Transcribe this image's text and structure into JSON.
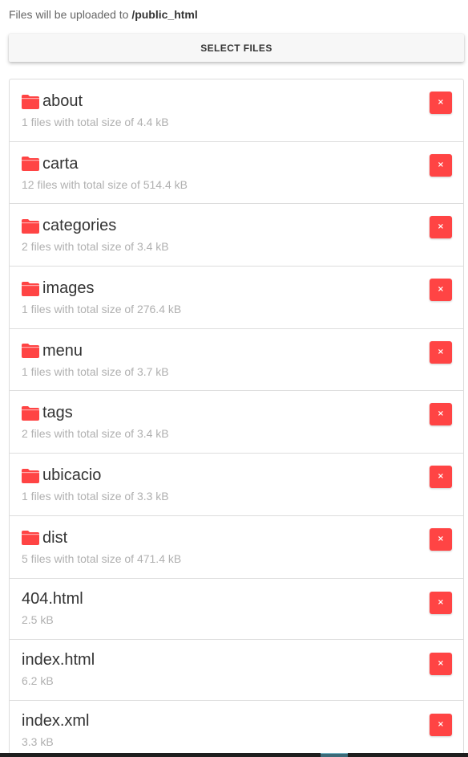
{
  "upload_info": {
    "prefix": "Files will be uploaded to",
    "path": "/public_html"
  },
  "select_button": {
    "label": "SELECT FILES"
  },
  "colors": {
    "accent_red": "#ff4444",
    "folder_icon": "#ff4444",
    "meta_text": "#b0b0b0"
  },
  "items": [
    {
      "type": "folder",
      "icon": "folder-icon",
      "name": "about",
      "meta": "1 files with total size of 4.4 kB",
      "remove_label": "×"
    },
    {
      "type": "folder",
      "icon": "folder-icon",
      "name": "carta",
      "meta": "12 files with total size of 514.4 kB",
      "remove_label": "×"
    },
    {
      "type": "folder",
      "icon": "folder-icon",
      "name": "categories",
      "meta": "2 files with total size of 3.4 kB",
      "remove_label": "×"
    },
    {
      "type": "folder",
      "icon": "folder-icon",
      "name": "images",
      "meta": "1 files with total size of 276.4 kB",
      "remove_label": "×"
    },
    {
      "type": "folder",
      "icon": "folder-icon",
      "name": "menu",
      "meta": "1 files with total size of 3.7 kB",
      "remove_label": "×"
    },
    {
      "type": "folder",
      "icon": "folder-icon",
      "name": "tags",
      "meta": "2 files with total size of 3.4 kB",
      "remove_label": "×"
    },
    {
      "type": "folder",
      "icon": "folder-icon",
      "name": "ubicacio",
      "meta": "1 files with total size of 3.3 kB",
      "remove_label": "×"
    },
    {
      "type": "folder",
      "icon": "folder-icon",
      "name": "dist",
      "meta": "5 files with total size of 471.4 kB",
      "remove_label": "×"
    },
    {
      "type": "file",
      "name": "404.html",
      "meta": "2.5 kB",
      "remove_label": "×"
    },
    {
      "type": "file",
      "name": "index.html",
      "meta": "6.2 kB",
      "remove_label": "×"
    },
    {
      "type": "file",
      "name": "index.xml",
      "meta": "3.3 kB",
      "remove_label": "×"
    }
  ]
}
